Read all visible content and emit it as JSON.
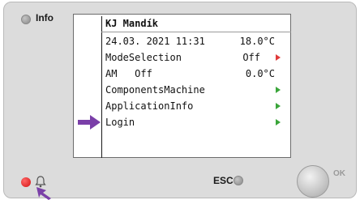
{
  "panel": {
    "info_label": "Info",
    "esc_label": "ESC",
    "ok_label": "OK"
  },
  "screen": {
    "title": "KJ Mandík",
    "datetime": "24.03. 2021 11:31",
    "temperature": "18.0°C",
    "rows": [
      {
        "label": "ModeSelection",
        "value": "Off",
        "arrow": "red"
      },
      {
        "label": "AM   Off",
        "value": "0.0°C",
        "arrow": "none"
      },
      {
        "label": "ComponentsMachine",
        "value": "",
        "arrow": "green"
      },
      {
        "label": "ApplicationInfo",
        "value": "",
        "arrow": "green"
      },
      {
        "label": "Login",
        "value": "",
        "arrow": "green"
      }
    ]
  },
  "colors": {
    "pointer_arrow": "#7a3fa8",
    "arrow_green": "#3aa53a",
    "arrow_red": "#e03a3a",
    "led_red": "#d31313"
  },
  "icons": [
    "bell-icon",
    "pointer-arrow-icon",
    "chevron-right-icon"
  ]
}
